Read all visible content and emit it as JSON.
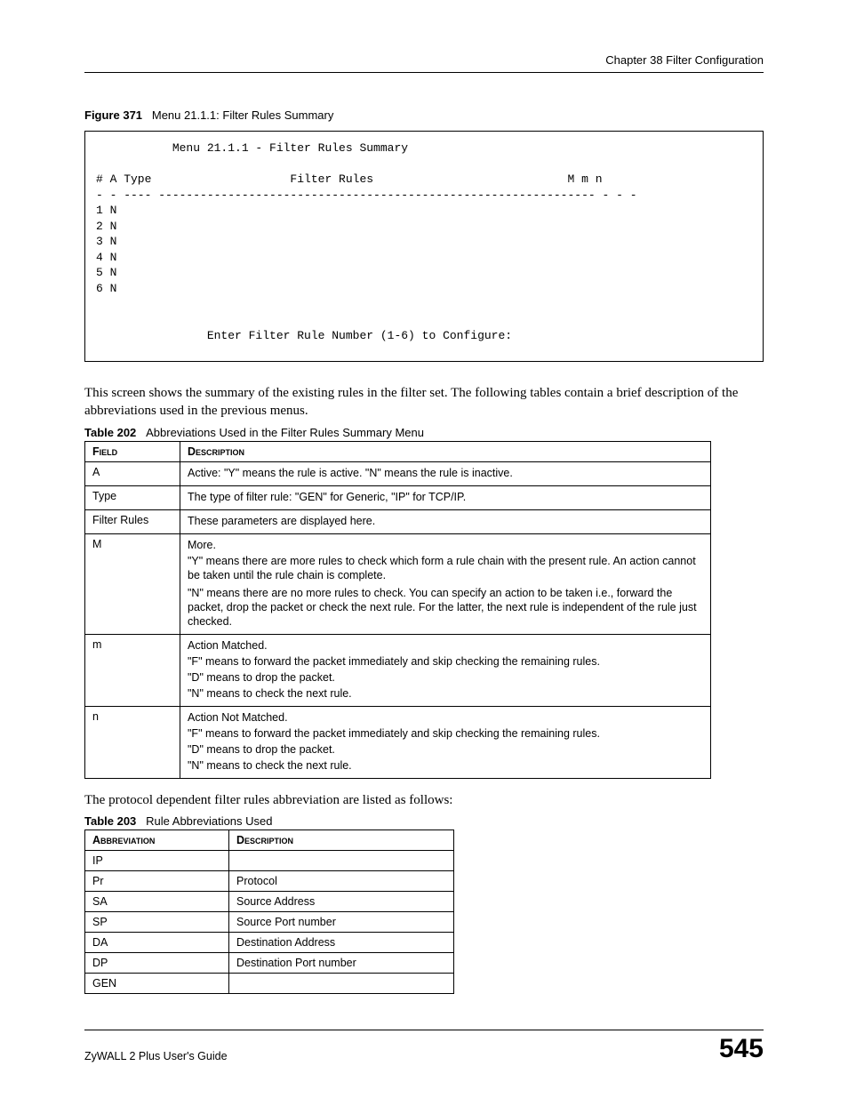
{
  "header": {
    "chapter": "Chapter 38 Filter Configuration"
  },
  "figure": {
    "label": "Figure 371",
    "title": "Menu 21.1.1: Filter Rules Summary"
  },
  "terminal": {
    "title": "Menu 21.1.1 - Filter Rules Summary",
    "cols_left": "# A Type",
    "cols_center": "Filter Rules",
    "cols_right": "M m n",
    "sep": "- - ---- --------------------------------------------------------------- - - -",
    "rows": [
      "1 N",
      "2 N",
      "3 N",
      "4 N",
      "5 N",
      "6 N"
    ],
    "prompt": "Enter Filter Rule Number (1-6) to Configure:"
  },
  "para1": "This screen shows the summary of the existing rules in the filter set. The following tables contain a brief description of the abbreviations used in the previous menus.",
  "table202": {
    "label": "Table 202",
    "title": "Abbreviations Used in the Filter Rules Summary Menu",
    "head": {
      "c1": "Field",
      "c2": "Description"
    },
    "rows": [
      {
        "f": "A",
        "d": [
          "Active: \"Y\" means the rule is active. \"N\" means the rule is inactive."
        ]
      },
      {
        "f": "Type",
        "d": [
          "The type of filter rule: \"GEN\" for Generic, \"IP\" for TCP/IP."
        ]
      },
      {
        "f": "Filter Rules",
        "d": [
          "These parameters are displayed here."
        ]
      },
      {
        "f": "M",
        "d": [
          "More.",
          "\"Y\" means there are more rules to check which form a rule chain with the present rule. An action cannot be taken until the rule chain is complete.",
          "\"N\" means there are no more rules to check. You can specify an action to be taken i.e., forward the packet, drop the packet or check the next rule. For the latter, the next rule is independent of the rule just checked."
        ]
      },
      {
        "f": "m",
        "d": [
          "Action Matched.",
          "\"F\" means to forward the packet immediately and skip checking the remaining rules.",
          "\"D\" means to drop the packet.",
          "\"N\" means to check the next rule."
        ]
      },
      {
        "f": "n",
        "d": [
          "Action Not Matched.",
          "\"F\" means to forward the packet immediately and skip checking the remaining rules.",
          "\"D\" means to drop the packet.",
          "\"N\" means to check the next rule."
        ]
      }
    ]
  },
  "para2": "The protocol dependent filter rules abbreviation are listed as follows:",
  "table203": {
    "label": "Table 203",
    "title": "Rule Abbreviations Used",
    "head": {
      "c1": "Abbreviation",
      "c2": "Description"
    },
    "rows": [
      {
        "a": "IP",
        "d": ""
      },
      {
        "a": "Pr",
        "d": "Protocol"
      },
      {
        "a": "SA",
        "d": "Source Address"
      },
      {
        "a": "SP",
        "d": "Source Port number"
      },
      {
        "a": "DA",
        "d": "Destination Address"
      },
      {
        "a": "DP",
        "d": "Destination Port number"
      },
      {
        "a": "GEN",
        "d": ""
      }
    ]
  },
  "footer": {
    "guide": "ZyWALL 2 Plus User's Guide",
    "page": "545"
  }
}
